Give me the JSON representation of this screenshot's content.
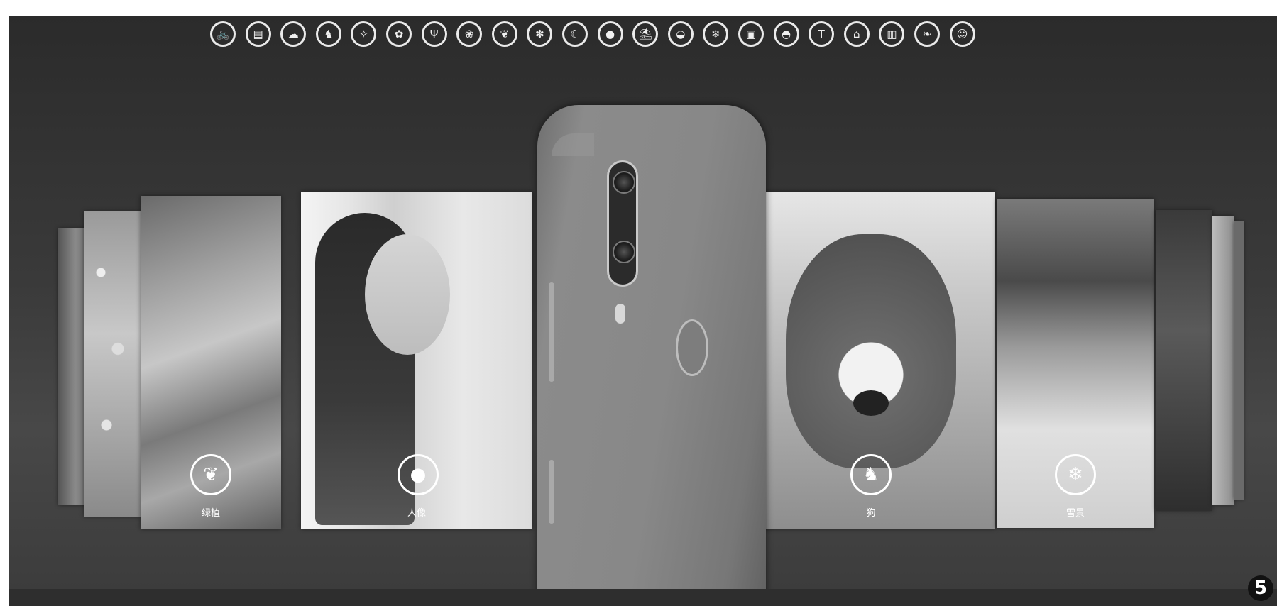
{
  "scene_icons": [
    {
      "name": "bicycle-icon",
      "glyph": "🚲"
    },
    {
      "name": "document-icon",
      "glyph": "▤"
    },
    {
      "name": "cloud-icon",
      "glyph": "☁"
    },
    {
      "name": "dog-icon",
      "glyph": "♞"
    },
    {
      "name": "sparkle-icon",
      "glyph": "✧"
    },
    {
      "name": "flower-icon",
      "glyph": "✿"
    },
    {
      "name": "food-icon",
      "glyph": "Ψ"
    },
    {
      "name": "lotus-icon",
      "glyph": "❀"
    },
    {
      "name": "leaf-icon",
      "glyph": "❦"
    },
    {
      "name": "blossom-icon",
      "glyph": "✽"
    },
    {
      "name": "night-icon",
      "glyph": "☾"
    },
    {
      "name": "person-icon",
      "glyph": "●"
    },
    {
      "name": "beach-icon",
      "glyph": "⛱"
    },
    {
      "name": "sunrise-icon",
      "glyph": "◒"
    },
    {
      "name": "snow-icon",
      "glyph": "❄"
    },
    {
      "name": "stage-icon",
      "glyph": "▣"
    },
    {
      "name": "sunset-icon",
      "glyph": "◓"
    },
    {
      "name": "text-icon",
      "glyph": "T"
    },
    {
      "name": "building-icon",
      "glyph": "⌂"
    },
    {
      "name": "panel-icon",
      "glyph": "▥"
    },
    {
      "name": "greenery-icon",
      "glyph": "❧"
    },
    {
      "name": "baby-icon",
      "glyph": "☺"
    }
  ],
  "cards": {
    "plants": {
      "label": "绿植",
      "icon": "leaf-icon",
      "glyph": "❦"
    },
    "portrait": {
      "label": "人像",
      "icon": "person-icon",
      "glyph": "●"
    },
    "dog": {
      "label": "狗",
      "icon": "dog-icon",
      "glyph": "♞"
    },
    "snow": {
      "label": "雪景",
      "icon": "snow-icon",
      "glyph": "❄"
    }
  },
  "figure_number": "5"
}
